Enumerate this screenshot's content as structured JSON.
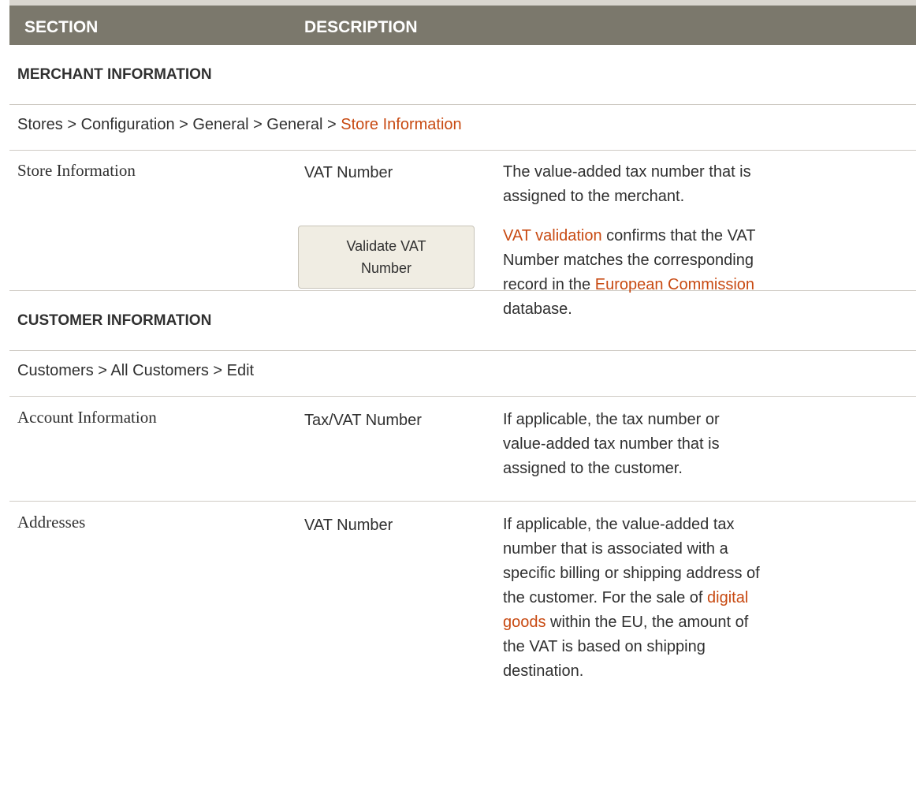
{
  "header": {
    "section": "SECTION",
    "description": "DESCRIPTION"
  },
  "merchant": {
    "title": "MERCHANT INFORMATION",
    "crumb_prefix": "Stores > Configuration > General > General > ",
    "crumb_link": "Store Information",
    "section_label": "Store Information",
    "field1_label": "VAT Number",
    "field1_desc": "The value-added tax number that is assigned to the merchant.",
    "button_label": "Validate VAT Number",
    "field2_link1": "VAT validation",
    "field2_text1": " confirms that the VAT Number matches the corresponding record in the ",
    "field2_link2": "European Commission",
    "field2_text2": " database."
  },
  "customer": {
    "title": "CUSTOMER INFORMATION",
    "crumb": "Customers > All Customers > Edit",
    "row1_section": "Account Information",
    "row1_label": "Tax/VAT Number",
    "row1_desc": "If applicable, the tax number or value-added tax number that is assigned to the customer.",
    "row2_section": "Addresses",
    "row2_label": "VAT Number",
    "row2_desc1": "If applicable, the value-added tax number that is associated with a specific billing or shipping address of the customer. For the sale of ",
    "row2_link": "digital goods",
    "row2_desc2": " within the EU, the amount of the VAT is based on shipping destination."
  }
}
